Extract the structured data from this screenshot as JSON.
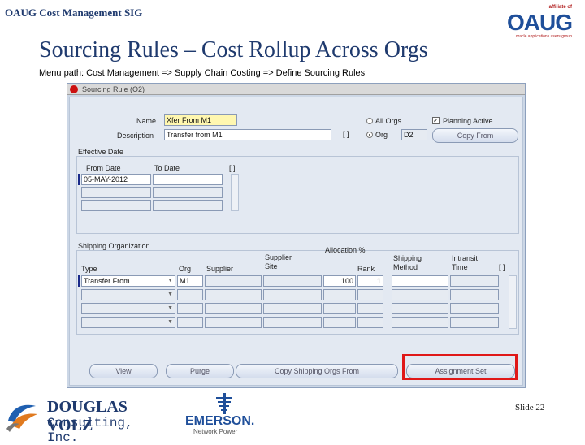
{
  "header": {
    "org_title": "OAUG Cost Management SIG",
    "logo_affiliate": "affiliate of",
    "logo_text": "OAUG",
    "logo_tagline": "oracle applications users group"
  },
  "slide": {
    "title": "Sourcing Rules – Cost Rollup Across Orgs",
    "menu_path": "Menu path: Cost Management => Supply Chain Costing => Define Sourcing Rules",
    "number": "Slide 22"
  },
  "window": {
    "title": "Sourcing Rule (O2)",
    "name_label": "Name",
    "name_value": "Xfer From M1",
    "description_label": "Description",
    "description_value": "Transfer from M1",
    "all_orgs_label": "All Orgs",
    "org_label": "Org",
    "org_value": "D2",
    "planning_active_label": "Planning Active",
    "copy_from_button": "Copy From",
    "effective_date_section": "Effective Date",
    "from_date_header": "From Date",
    "to_date_header": "To Date",
    "from_date_value": "05-MAY-2012",
    "shipping_org_section": "Shipping Organization",
    "allocation_label": "Allocation %",
    "col_type": "Type",
    "col_org": "Org",
    "col_supplier": "Supplier",
    "col_supplier_site_1": "Supplier",
    "col_supplier_site_2": "Site",
    "col_rank": "Rank",
    "col_shipping_1": "Shipping",
    "col_shipping_2": "Method",
    "col_intransit_1": "Intransit",
    "col_intransit_2": "Time",
    "row1_type": "Transfer From",
    "row1_org": "M1",
    "row1_allocation": "100",
    "row1_rank": "1",
    "btn_view": "View",
    "btn_purge": "Purge",
    "btn_copy_shipping": "Copy Shipping Orgs From",
    "btn_assignment": "Assignment Set"
  },
  "footer": {
    "dv_name": "DOUGLAS VOLZ",
    "dv_sub": "Consulting, Inc.",
    "emerson_name": "EMERSON.",
    "emerson_sub": "Network Power"
  },
  "colors": {
    "accent": "#1f3a6e",
    "highlight": "#e01818"
  }
}
